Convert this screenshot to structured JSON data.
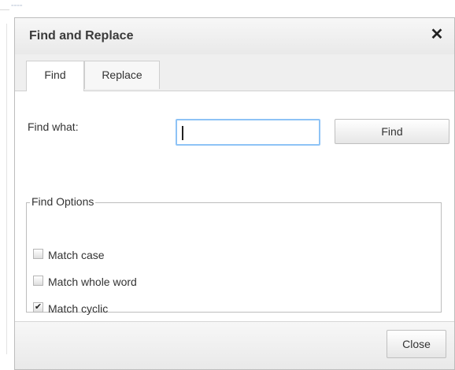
{
  "dialog": {
    "title": "Find and Replace",
    "close_icon": "close-icon"
  },
  "tabs": {
    "items": [
      {
        "label": "Find",
        "active": true
      },
      {
        "label": "Replace",
        "active": false
      }
    ]
  },
  "find": {
    "label": "Find what:",
    "input_value": "",
    "button_label": "Find"
  },
  "options": {
    "legend": "Find Options",
    "items": [
      {
        "label": "Match case",
        "checked": false
      },
      {
        "label": "Match whole word",
        "checked": false
      },
      {
        "label": "Match cyclic",
        "checked": true
      }
    ]
  },
  "footer": {
    "close_label": "Close"
  },
  "colors": {
    "input_focus_border": "#8ec3f6",
    "title_text": "#3a3a3a",
    "background": "#ffffff"
  }
}
